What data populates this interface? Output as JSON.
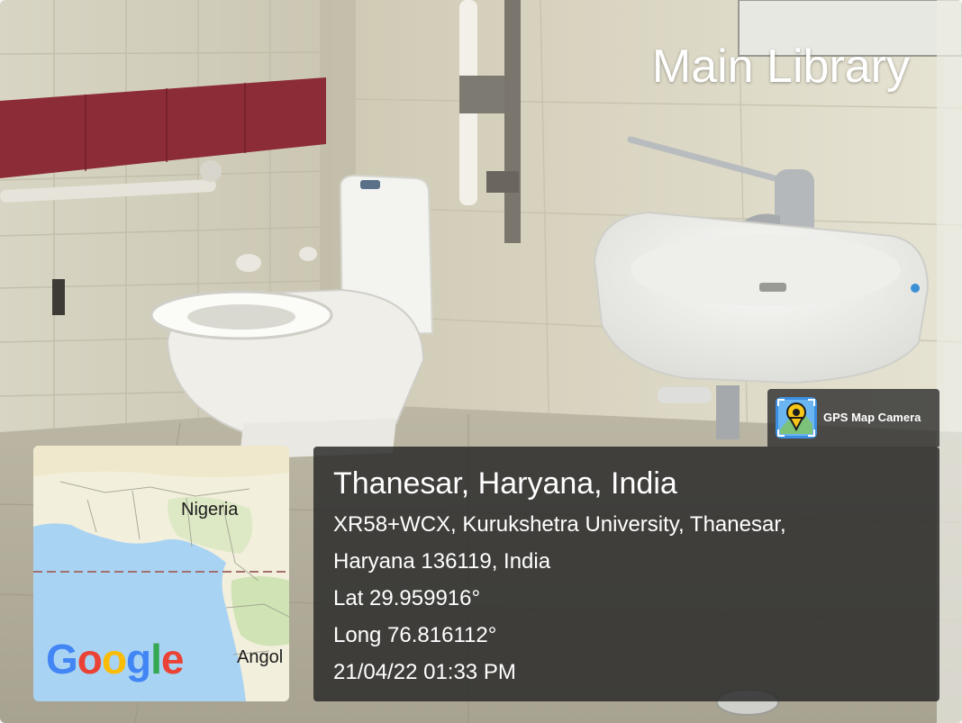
{
  "location_tag": "Main Library",
  "app": {
    "name": "GPS Map Camera",
    "icon": "gps-pin-icon"
  },
  "location": {
    "city": "Thanesar, Haryana, India",
    "address_line1": "XR58+WCX, Kurukshetra University, Thanesar,",
    "address_line2": "Haryana 136119, India",
    "latitude": "Lat 29.959916°",
    "longitude": "Long 76.816112°",
    "datetime": "21/04/22 01:33 PM"
  },
  "map": {
    "country_label_1": "Nigeria",
    "country_label_2": "Angol",
    "google_logo": {
      "g1": "G",
      "o1": "o",
      "o2": "o",
      "g2": "g",
      "l": "l",
      "e": "e"
    }
  },
  "colors": {
    "panel": "#2a2a2a",
    "tile_stripe": "#8c2c36",
    "ocean": "#a9d3f3",
    "land": "#f2efdc"
  }
}
